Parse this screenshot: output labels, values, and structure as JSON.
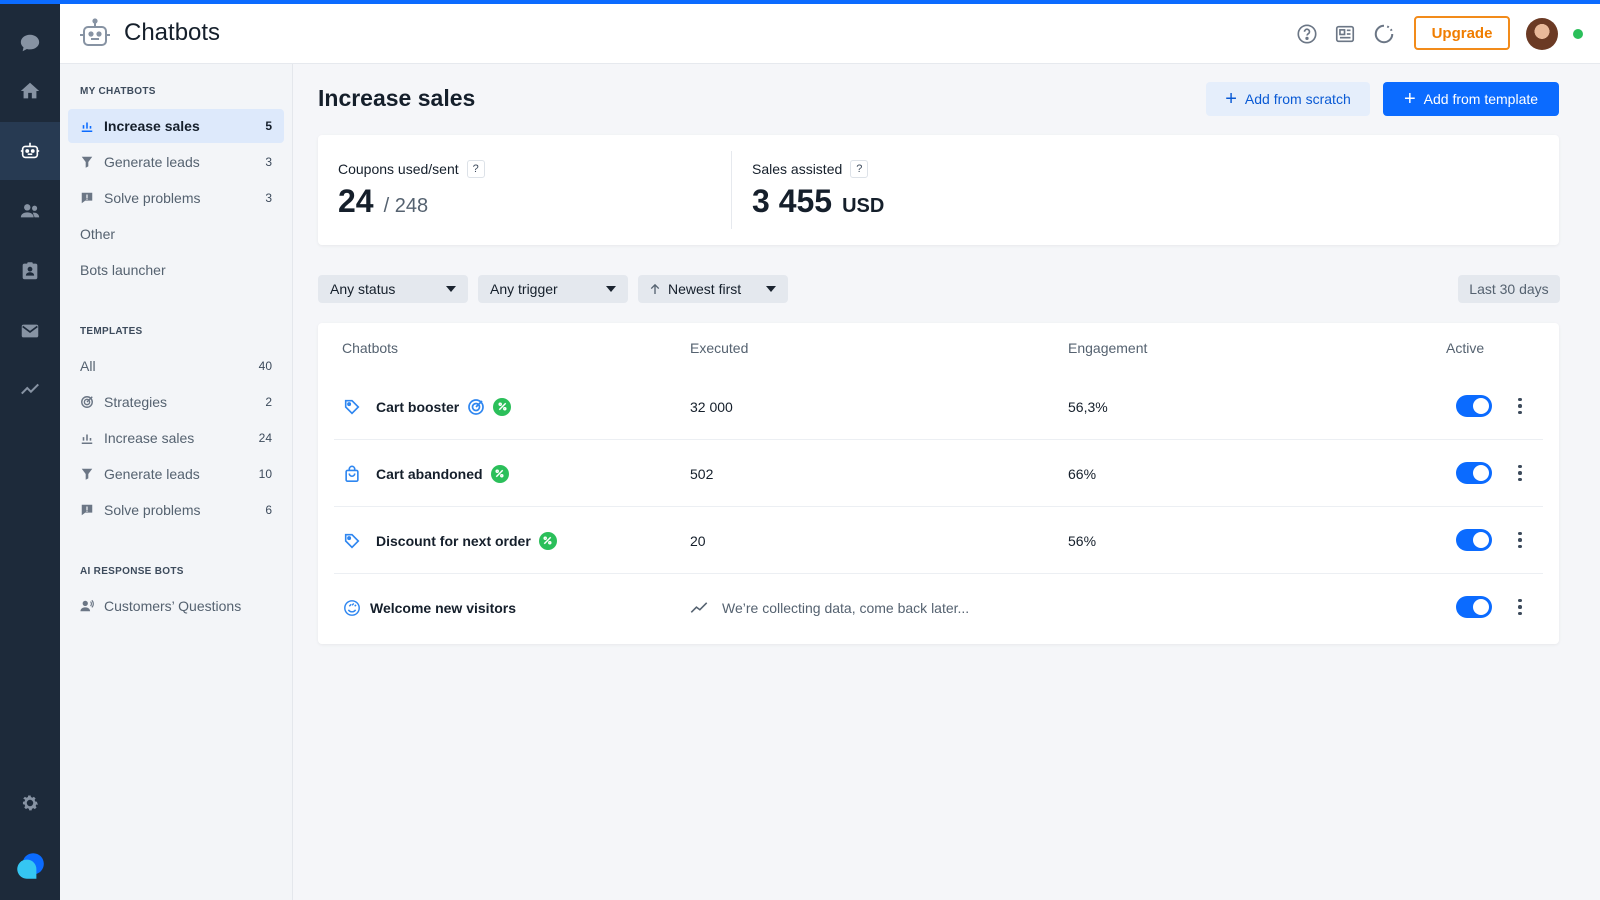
{
  "app": {
    "title": "Chatbots",
    "upgrade_label": "Upgrade"
  },
  "colors": {
    "accent": "#0b6bff",
    "rail_bg": "#1d2a3a",
    "upgrade": "#f28b1a",
    "badge_green": "#2bbf5a",
    "online": "#2bbf5a"
  },
  "rail": {
    "items": [
      {
        "icon": "chat-icon"
      },
      {
        "icon": "home-icon"
      },
      {
        "icon": "chatbot-icon",
        "active": true
      },
      {
        "icon": "contacts-icon"
      },
      {
        "icon": "tickets-icon"
      },
      {
        "icon": "campaigns-icon"
      },
      {
        "icon": "analytics-icon"
      }
    ],
    "bottom": [
      {
        "icon": "settings-icon"
      },
      {
        "icon": "tidio-logo-icon"
      }
    ]
  },
  "topbar_icons": [
    "help-icon",
    "news-icon",
    "loading-icon"
  ],
  "sidebar": {
    "my_title": "MY CHATBOTS",
    "my_items": [
      {
        "label": "Increase sales",
        "count": "5",
        "icon": "sales-icon",
        "active": true
      },
      {
        "label": "Generate leads",
        "count": "3",
        "icon": "funnel-icon"
      },
      {
        "label": "Solve problems",
        "count": "3",
        "icon": "problem-icon"
      },
      {
        "label": "Other",
        "count": ""
      },
      {
        "label": "Bots launcher",
        "count": ""
      }
    ],
    "templates_title": "TEMPLATES",
    "template_items": [
      {
        "label": "All",
        "count": "40"
      },
      {
        "label": "Strategies",
        "count": "2",
        "icon": "strategy-icon"
      },
      {
        "label": "Increase sales",
        "count": "24",
        "icon": "sales-icon"
      },
      {
        "label": "Generate leads",
        "count": "10",
        "icon": "funnel-icon"
      },
      {
        "label": "Solve problems",
        "count": "6",
        "icon": "problem-icon"
      }
    ],
    "ai_title": "AI RESPONSE BOTS",
    "ai_items": [
      {
        "label": "Customers’ Questions",
        "icon": "ai-person-icon"
      }
    ]
  },
  "main": {
    "title": "Increase sales",
    "add_scratch": "Add from scratch",
    "add_template": "Add from template",
    "stats": {
      "coupons_label": "Coupons used/sent",
      "coupons_used": "24",
      "coupons_sent": "/ 248",
      "sales_label": "Sales assisted",
      "sales_value": "3 455",
      "sales_unit": "USD",
      "help": "?"
    },
    "filters": {
      "status": "Any status",
      "trigger": "Any trigger",
      "sort": "Newest first",
      "range": "Last 30 days"
    },
    "table": {
      "headers": {
        "name": "Chatbots",
        "executed": "Executed",
        "engagement": "Engagement",
        "active": "Active"
      },
      "rows": [
        {
          "name": "Cart booster",
          "executed": "32 000",
          "engagement": "56,3%",
          "icon": "tag-icon",
          "active": true
        },
        {
          "name": "Cart abandoned",
          "executed": "502",
          "engagement": "66%",
          "icon": "shopping-bag-icon",
          "active": true
        },
        {
          "name": "Discount for next order",
          "executed": "20",
          "engagement": "56%",
          "icon": "tag-icon",
          "active": true
        },
        {
          "name": "Welcome new visitors",
          "collecting": "We’re collecting data, come back later...",
          "icon": "wave-hand-icon",
          "active": true
        }
      ]
    }
  }
}
